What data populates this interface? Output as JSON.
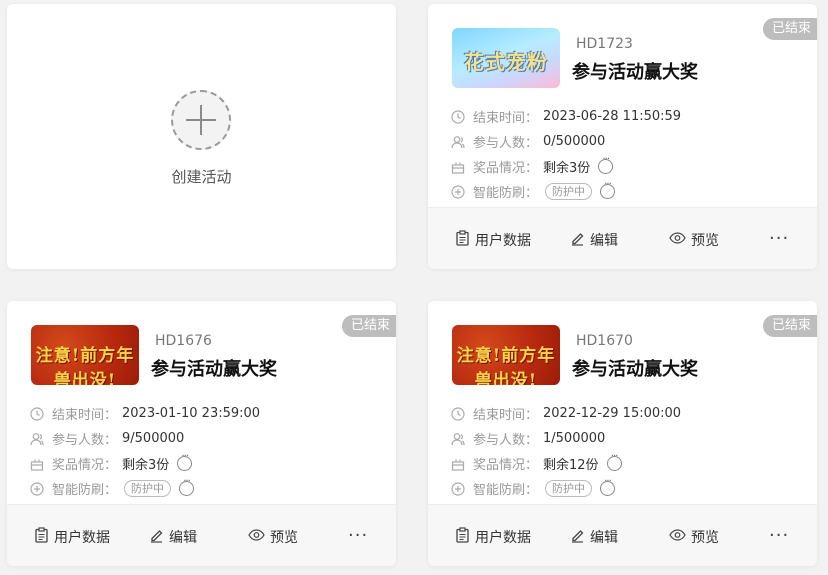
{
  "create": {
    "label": "创建活动"
  },
  "labels": {
    "end_time": "结束时间：",
    "participants": "参与人数：",
    "prizes": "奖品情况：",
    "anti_fraud": "智能防刷：",
    "protecting": "防护中",
    "ended": "已结束",
    "user_data": "用户数据",
    "edit": "编辑",
    "preview": "预览",
    "more": "···"
  },
  "activities": [
    {
      "code": "HD1723",
      "title": "参与活动赢大奖",
      "end_time": "2023-06-28 11:50:59",
      "participants": "0/500000",
      "prizes": "剩余3份",
      "thumb_text": "花式宠粉",
      "thumb_style": "blue"
    },
    {
      "code": "HD1676",
      "title": "参与活动赢大奖",
      "end_time": "2023-01-10 23:59:00",
      "participants": "9/500000",
      "prizes": "剩余3份",
      "thumb_text": "注意!前方年兽出没!",
      "thumb_style": "red"
    },
    {
      "code": "HD1670",
      "title": "参与活动赢大奖",
      "end_time": "2022-12-29 15:00:00",
      "participants": "1/500000",
      "prizes": "剩余12份",
      "thumb_text": "注意!前方年兽出没!",
      "thumb_style": "red"
    }
  ]
}
